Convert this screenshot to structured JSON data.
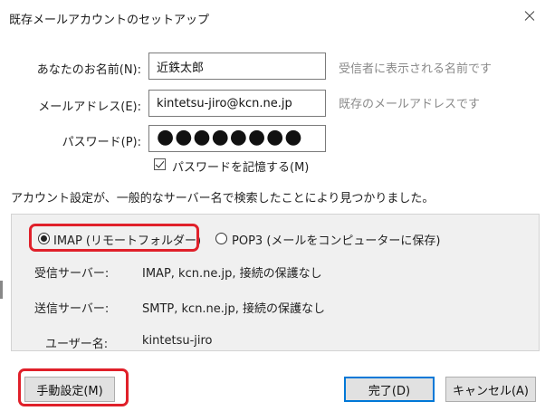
{
  "window": {
    "title": "既存メールアカウントのセットアップ",
    "close_glyph": "✕"
  },
  "form": {
    "name_label": "あなたのお名前(N):",
    "name_value": "近鉄太郎",
    "name_hint": "受信者に表示される名前です",
    "email_label": "メールアドレス(E):",
    "email_value": "kintetsu-jiro@kcn.ne.jp",
    "email_hint": "既存のメールアドレスです",
    "password_label": "パスワード(P):",
    "password_mask": "●●●●●●●●",
    "remember_label": "パスワードを記憶する(M)",
    "remember_checked": true
  },
  "status_message": "アカウント設定が、一般的なサーバー名で検索したことにより見つかりました。",
  "protocol": {
    "imap_label": "IMAP (リモートフォルダー)",
    "pop3_label": "POP3 (メールをコンピューターに保存)",
    "selected": "imap"
  },
  "servers": {
    "incoming_label": "受信サーバー:",
    "incoming_value": "IMAP, kcn.ne.jp, 接続の保護なし",
    "outgoing_label": "送信サーバー:",
    "outgoing_value": "SMTP, kcn.ne.jp, 接続の保護なし",
    "username_label": "ユーザー名:",
    "username_value": "kintetsu-jiro"
  },
  "buttons": {
    "manual": "手動設定(M)",
    "done": "完了(D)",
    "cancel": "キャンセル(A)"
  },
  "colors": {
    "highlight": "#e0202a",
    "default_button": "#0078d7"
  }
}
